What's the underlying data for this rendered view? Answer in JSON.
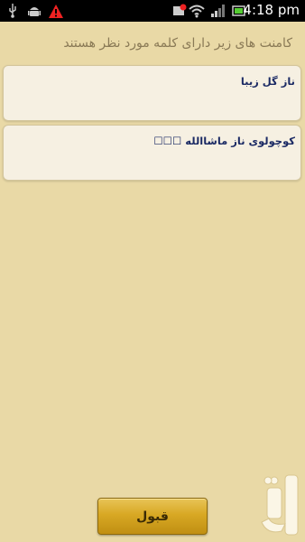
{
  "status_bar": {
    "time": "4:18 pm",
    "icons": [
      "usb-icon",
      "android-icon",
      "warning-icon",
      "notification-icon",
      "wifi-icon",
      "battery-icon",
      "signal-icon"
    ]
  },
  "header": {
    "text": "کامنت های زیر دارای کلمه مورد نظر هستند"
  },
  "comments": [
    {
      "text": "ناز گل زیبا"
    },
    {
      "text": "کوچولوی ناز ماشاالله ☐☐☐"
    }
  ],
  "footer": {
    "accept_label": "قبول"
  },
  "colors": {
    "background": "#e9d9a6",
    "card": "#f6f0e2",
    "comment_text": "#1b2a64",
    "button_gold": "#d8a824"
  }
}
